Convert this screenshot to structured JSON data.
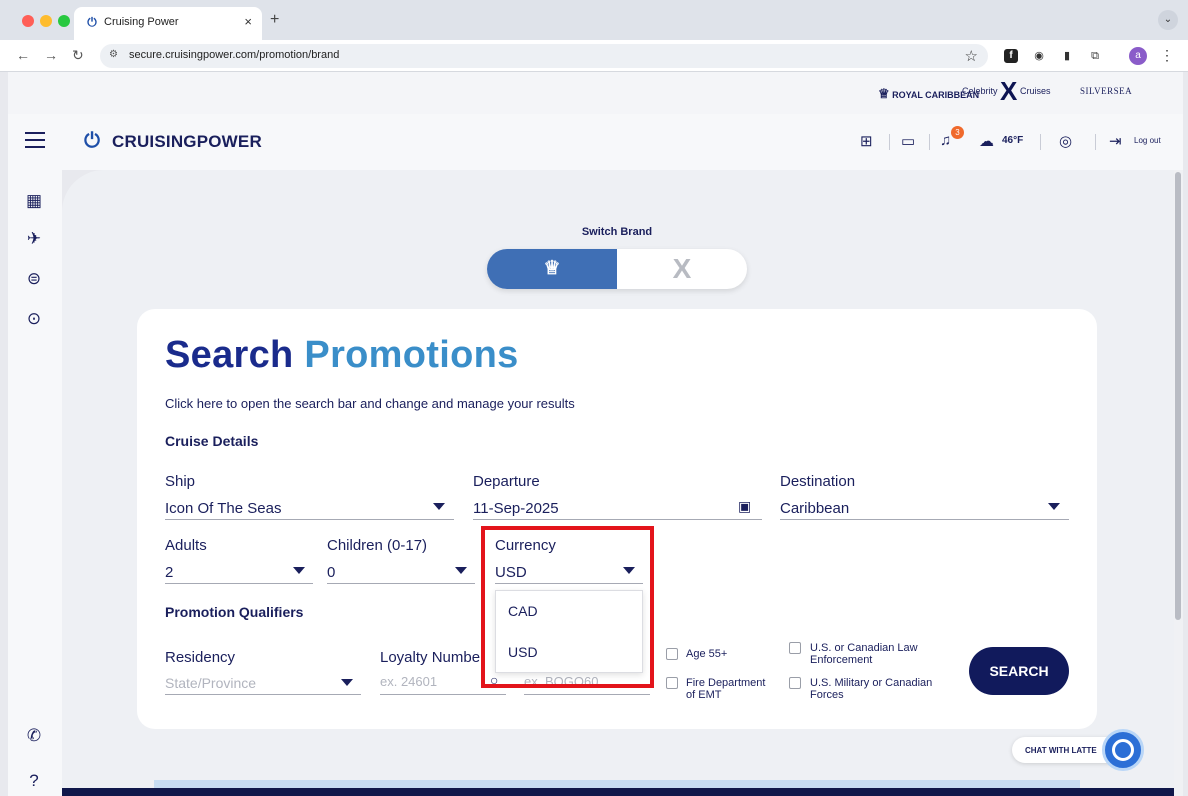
{
  "browser": {
    "tab_title": "Cruising Power",
    "tab_close": "×",
    "new_tab": "+",
    "url": "secure.cruisingpower.com/promotion/brand",
    "profile_initial": "a",
    "traffic_lights": [
      "#ff5f57",
      "#febc2e",
      "#28c840"
    ]
  },
  "brand_strip": {
    "royal_caribbean": "ROYAL CARIBBEAN",
    "celebrity_left": "Celebrity",
    "celebrity_x": "X",
    "celebrity_right": "Cruises",
    "silversea": "SILVERSEA"
  },
  "header": {
    "logo_text": "CRUISINGPOWER",
    "notification_count": "3",
    "weather_temp": "46°F",
    "logout_label": "Log out",
    "icons": [
      "apps-grid-icon",
      "chat-icon",
      "bell-icon",
      "cloud-icon",
      "user-icon",
      "logout-icon"
    ]
  },
  "left_rail": {
    "icons": [
      "calendar-add-icon",
      "airplane-icon",
      "globe-coin-icon",
      "location-pin-icon",
      "chat-bubble-icon",
      "help-icon"
    ]
  },
  "switch_brand": {
    "label": "Switch Brand",
    "active": "royal-caribbean"
  },
  "search": {
    "title_part1": "Search",
    "title_part2": "Promotions",
    "subtitle": "Click here to open the search bar and change and manage your results",
    "cruise_details_label": "Cruise Details",
    "ship": {
      "label": "Ship",
      "value": "Icon Of The Seas"
    },
    "departure": {
      "label": "Departure",
      "value": "11-Sep-2025"
    },
    "destination": {
      "label": "Destination",
      "value": "Caribbean"
    },
    "adults": {
      "label": "Adults",
      "value": "2"
    },
    "children": {
      "label": "Children (0-17)",
      "value": "0"
    },
    "currency": {
      "label": "Currency",
      "value": "USD",
      "options": [
        "CAD",
        "USD"
      ]
    },
    "promotion_qualifiers_label": "Promotion Qualifiers",
    "residency": {
      "label": "Residency",
      "placeholder": "State/Province"
    },
    "loyalty": {
      "label": "Loyalty Number",
      "placeholder": "ex. 24601"
    },
    "promo_code": {
      "placeholder": "ex. BOGO60"
    },
    "checkboxes": {
      "age55": "Age 55+",
      "law_line1": "U.S. or Canadian Law",
      "law_line2": "Enforcement",
      "fire_line1": "Fire Department",
      "fire_line2": "of EMT",
      "military_line1": "U.S. Military or Canadian",
      "military_line2": "Forces"
    },
    "search_button": "SEARCH"
  },
  "chat": {
    "label": "CHAT WITH LATTE"
  },
  "colors": {
    "primary_navy": "#111a5c",
    "title_blue": "#1a2b8c",
    "title_accent": "#3a8ec9",
    "switch_active": "#3f6fb5",
    "highlight_red": "#e3141b",
    "badge_orange": "#f06a2c"
  }
}
